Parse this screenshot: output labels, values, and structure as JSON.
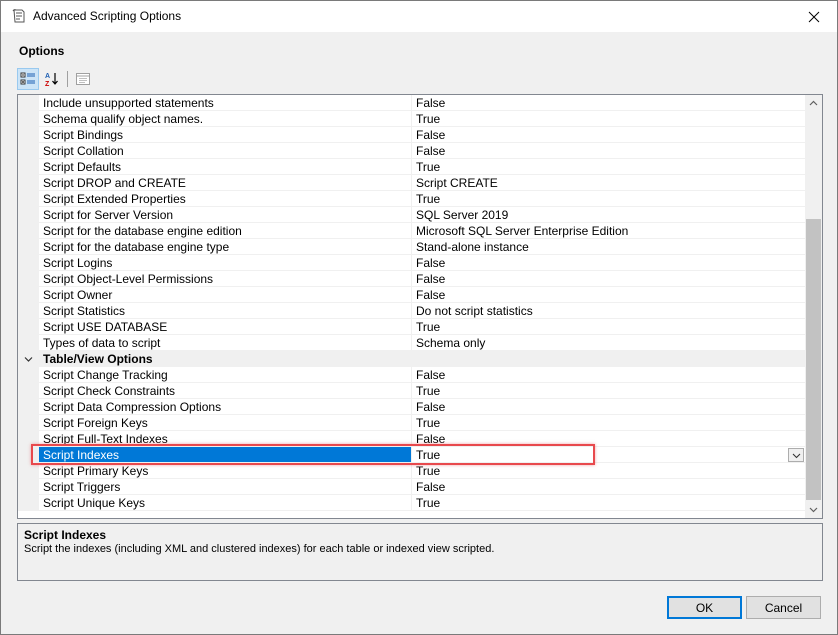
{
  "window": {
    "title": "Advanced Scripting Options"
  },
  "options_label": "Options",
  "toolbar": {
    "categorized_icon": "categorized-icon",
    "alphabetical_icon": "alphabetical-sort-icon",
    "property_pages_icon": "property-pages-icon"
  },
  "properties": [
    {
      "name": "Include unsupported statements",
      "value": "False"
    },
    {
      "name": "Schema qualify object names.",
      "value": "True"
    },
    {
      "name": "Script Bindings",
      "value": "False"
    },
    {
      "name": "Script Collation",
      "value": "False"
    },
    {
      "name": "Script Defaults",
      "value": "True"
    },
    {
      "name": "Script DROP and CREATE",
      "value": "Script CREATE"
    },
    {
      "name": "Script Extended Properties",
      "value": "True"
    },
    {
      "name": "Script for Server Version",
      "value": "SQL Server 2019"
    },
    {
      "name": "Script for the database engine edition",
      "value": "Microsoft SQL Server Enterprise Edition"
    },
    {
      "name": "Script for the database engine type",
      "value": "Stand-alone instance"
    },
    {
      "name": "Script Logins",
      "value": "False"
    },
    {
      "name": "Script Object-Level Permissions",
      "value": "False"
    },
    {
      "name": "Script Owner",
      "value": "False"
    },
    {
      "name": "Script Statistics",
      "value": "Do not script statistics"
    },
    {
      "name": "Script USE DATABASE",
      "value": "True"
    },
    {
      "name": "Types of data to script",
      "value": "Schema only"
    }
  ],
  "category": {
    "name": "Table/View Options"
  },
  "table_properties": [
    {
      "name": "Script Change Tracking",
      "value": "False"
    },
    {
      "name": "Script Check Constraints",
      "value": "True"
    },
    {
      "name": "Script Data Compression Options",
      "value": "False"
    },
    {
      "name": "Script Foreign Keys",
      "value": "True"
    },
    {
      "name": "Script Full-Text Indexes",
      "value": "False"
    },
    {
      "name": "Script Indexes",
      "value": "True",
      "selected": true
    },
    {
      "name": "Script Primary Keys",
      "value": "True"
    },
    {
      "name": "Script Triggers",
      "value": "False"
    },
    {
      "name": "Script Unique Keys",
      "value": "True"
    }
  ],
  "description": {
    "title": "Script Indexes",
    "text": "Script the indexes (including XML and clustered indexes) for each table or indexed view scripted."
  },
  "buttons": {
    "ok": "OK",
    "cancel": "Cancel"
  },
  "colors": {
    "selection": "#0078d7",
    "highlight_outline": "#e8494d"
  }
}
